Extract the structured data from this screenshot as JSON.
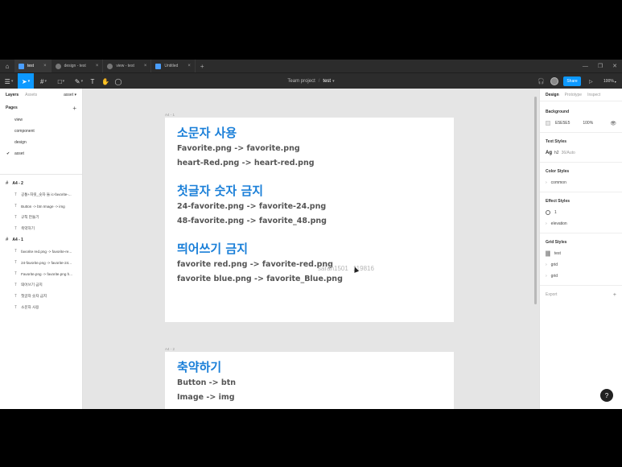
{
  "tabs": [
    {
      "label": "test",
      "active": true
    },
    {
      "label": "design - test",
      "active": false
    },
    {
      "label": "view - test",
      "active": false
    },
    {
      "label": "Untitled",
      "active": false
    }
  ],
  "toolbar": {
    "project": "Team project",
    "separator": "/",
    "file": "test",
    "share": "Share",
    "zoom": "100%"
  },
  "left": {
    "tab_layers": "Layers",
    "tab_assets": "Assets",
    "current_page": "asset",
    "pages_title": "Pages",
    "pages": [
      {
        "label": "view",
        "active": false
      },
      {
        "label": "component",
        "active": false
      },
      {
        "label": "design",
        "active": false
      },
      {
        "label": "asset",
        "active": true
      }
    ],
    "frames": [
      {
        "label": "A4 - 2",
        "children": [
          "공통+자릿_숫자 들 ic-favorite-...",
          "Button -> btn Image -> img",
          "규칙 만들기",
          "축약하기"
        ]
      },
      {
        "label": "A4 - 1",
        "children": [
          "favorite red.png -> favorite-re...",
          "24-favorite.png -> favorite-24...",
          "Favorite.png -> favorite.png h...",
          "띄어쓰기 금지",
          "첫글자 숫자 금지",
          "소문자 사용"
        ]
      }
    ]
  },
  "canvas": {
    "frame1_label": "A4 - 1",
    "frame2_label": "A4 - 2",
    "s1_title": "소문자 사용",
    "s1_line1": "Favorite.png -> favorite.png",
    "s1_line2": "heart-Red.png -> heart-red.png",
    "s2_title": "첫글자 숫자 금지",
    "s2_line1": "24-favorite.png -> favorite-24.png",
    "s2_line2": "48-favorite.png -> favorite_48.png",
    "s3_title": "띄어쓰기 금지",
    "s3_line1": "favorite red.png -> favorite-red.png",
    "s3_line2": "favorite blue.png -> favorite_Blue.png",
    "f2_title": "축약하기",
    "f2_line1": "Button -> btn",
    "f2_line2": "Image -> img",
    "watermark": "sarah1501",
    "watermark_tail": "119816"
  },
  "right": {
    "tab_design": "Design",
    "tab_prototype": "Prototype",
    "tab_inspect": "Inspect",
    "background_title": "Background",
    "bg_hex": "E5E5E5",
    "bg_opacity": "100%",
    "text_styles_title": "Text Styles",
    "text_style_sample": "Ag",
    "text_style_name": "h2",
    "text_style_meta": "36/Auto",
    "color_styles_title": "Color Styles",
    "color_style_item": "common",
    "effect_styles_title": "Effect Styles",
    "effect_item1": "1",
    "effect_item2": "elevation",
    "grid_styles_title": "Grid Styles",
    "grid_items": [
      "test",
      "grid",
      "grid"
    ],
    "export_title": "Export"
  }
}
